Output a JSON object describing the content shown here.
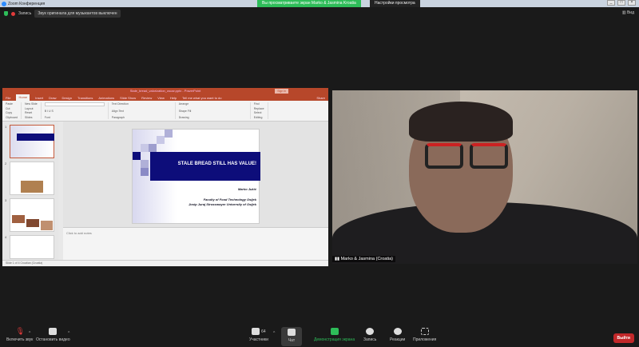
{
  "taskbar": {
    "app_title": "Zoom Конференция"
  },
  "banner": {
    "sharing_text": "Вы просматриваете экран Marko & Jasmina Kroatia",
    "view_options": "Настройки просмотра"
  },
  "zoom_bar": {
    "record_label": "Запись",
    "notice": "Звук оригинала для музыкантов выключен",
    "view_label": "Вид"
  },
  "powerpoint": {
    "title": "Stale_bread_valorization_oscar.pptx - PowerPoint",
    "sign_in": "Sign in",
    "tabs": [
      "File",
      "Home",
      "Insert",
      "Draw",
      "Design",
      "Transitions",
      "Animations",
      "Slide Show",
      "Review",
      "View",
      "Help",
      "Tell me what you want to do"
    ],
    "share": "Share",
    "groups": [
      "Clipboard",
      "Slides",
      "Font",
      "Paragraph",
      "Drawing",
      "Editing"
    ],
    "ribbon_items": [
      "Paste",
      "Cut",
      "Copy",
      "Format Painter",
      "New Slide",
      "Layout",
      "Reset",
      "Section",
      "Text Direction",
      "Align Text",
      "Convert to SmartArt",
      "Arrange",
      "Quick Styles",
      "Shape Fill",
      "Shape Outline",
      "Shape Effects",
      "Find",
      "Replace",
      "Select"
    ],
    "slide_numbers": [
      "1",
      "2",
      "3",
      "4"
    ],
    "slide": {
      "title": "STALE BREAD STILL HAS VALUE!",
      "author": "Marko Jukić",
      "line1": "Faculty of Food Technology Osijek",
      "line2": "Josip Juraj Strossmayer University of Osijek"
    },
    "notes_placeholder": "Click to add notes",
    "status": "Slide 1 of 4   Croatian (Croatia)"
  },
  "video": {
    "participant_name": "Marko & Jasmina (Croatia)"
  },
  "toolbar": {
    "unmute": "Включить звук",
    "start_video": "Остановить видео",
    "participants": "Участники",
    "participants_count": "64",
    "chat": "Чат",
    "share_screen": "Демонстрация экрана",
    "record": "Запись",
    "reactions": "Реакции",
    "apps": "Приложения",
    "leave": "Выйти"
  }
}
